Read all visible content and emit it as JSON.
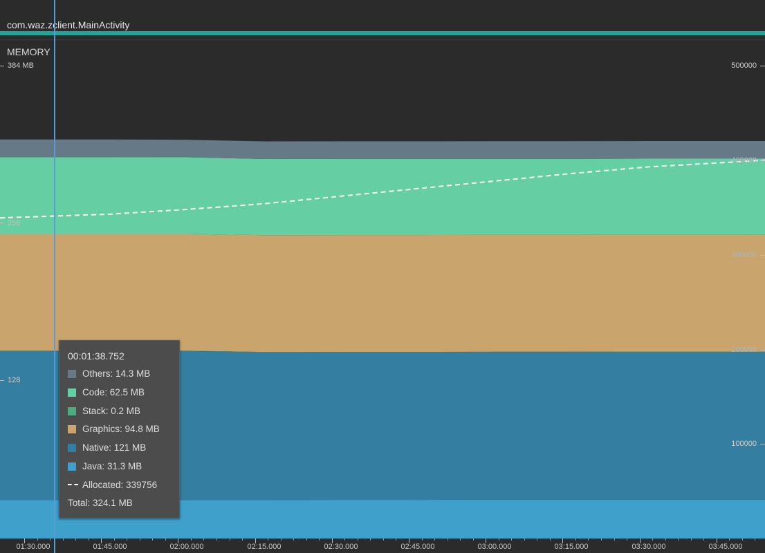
{
  "window": {
    "activity": "com.waz.zclient.MainActivity",
    "accent_color": "#22a39a"
  },
  "memory_panel": {
    "title": "MEMORY",
    "left_axis": {
      "top_label": "384 MB",
      "mid_label": "256",
      "low_label": "128"
    },
    "right_axis": {
      "labels": [
        "500000",
        "400000",
        "300000",
        "200000",
        "100000"
      ],
      "values": [
        500000,
        400000,
        300000,
        200000,
        100000
      ]
    }
  },
  "chart_data": {
    "type": "area",
    "stacked": true,
    "x_unit": "time",
    "x": [
      "01:30.000",
      "01:45.000",
      "02:00.000",
      "02:15.000",
      "02:30.000",
      "02:45.000",
      "03:00.000",
      "03:15.000",
      "03:30.000",
      "03:45.000"
    ],
    "x_ticks": [
      "01:30.000",
      "01:45.000",
      "02:00.000",
      "02:15.000",
      "02:30.000",
      "02:45.000",
      "03:00.000",
      "03:15.000",
      "03:30.000",
      "03:45.000"
    ],
    "y_left_range_mb": [
      0,
      384
    ],
    "y_right_range": [
      0,
      500000
    ],
    "series": [
      {
        "name": "Java",
        "color": "#3fa0cc",
        "values": [
          31.3,
          31.3,
          31.3,
          31.3,
          31.4,
          31.4,
          31.5,
          31.5,
          31.6,
          31.6
        ]
      },
      {
        "name": "Native",
        "color": "#347ea1",
        "values": [
          121,
          121,
          121,
          120,
          120,
          120,
          120,
          120,
          120,
          120
        ]
      },
      {
        "name": "Stack",
        "color": "#4daa7f",
        "values": [
          0.2,
          0.2,
          0.2,
          0.2,
          0.2,
          0.2,
          0.2,
          0.2,
          0.2,
          0.2
        ]
      },
      {
        "name": "Graphics",
        "color": "#c9a46d",
        "values": [
          94.8,
          94.8,
          94.8,
          94.8,
          94.8,
          94.8,
          94.8,
          94.8,
          94.8,
          94.8
        ]
      },
      {
        "name": "Code",
        "color": "#66ceA3",
        "values": [
          62.5,
          62.5,
          62.3,
          61.9,
          61.9,
          61.9,
          61.9,
          61.9,
          61.9,
          61.9
        ]
      },
      {
        "name": "Others",
        "color": "#667986",
        "values": [
          14.3,
          14.3,
          14.2,
          14.3,
          14.3,
          14.3,
          14.3,
          14.3,
          14.3,
          14.3
        ]
      }
    ],
    "allocated": {
      "name": "Allocated",
      "axis": "right",
      "style": "dashed",
      "color": "#ffffff",
      "values": [
        339000,
        343000,
        348000,
        354000,
        362000,
        370000,
        378000,
        386000,
        393000,
        400000
      ]
    }
  },
  "tooltip": {
    "time": "00:01:38.752",
    "rows": [
      {
        "label": "Others: 14.3 MB",
        "color": "#667986",
        "kind": "swatch"
      },
      {
        "label": "Code: 62.5 MB",
        "color": "#66cea3",
        "kind": "swatch"
      },
      {
        "label": "Stack: 0.2 MB",
        "color": "#4daa7f",
        "kind": "swatch"
      },
      {
        "label": "Graphics: 94.8 MB",
        "color": "#c9a46d",
        "kind": "swatch"
      },
      {
        "label": "Native: 121 MB",
        "color": "#347ea1",
        "kind": "swatch"
      },
      {
        "label": "Java: 31.3 MB",
        "color": "#3fa0cc",
        "kind": "swatch"
      },
      {
        "label": "Allocated: 339756",
        "color": "#ffffff",
        "kind": "dashed"
      }
    ],
    "total": "Total: 324.1 MB"
  }
}
